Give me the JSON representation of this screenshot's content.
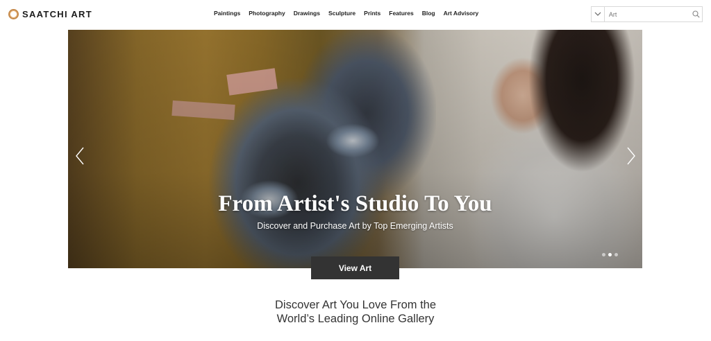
{
  "header": {
    "logo_text": "SAATCHI ART",
    "nav": [
      {
        "label": "Paintings"
      },
      {
        "label": "Photography"
      },
      {
        "label": "Drawings"
      },
      {
        "label": "Sculpture"
      },
      {
        "label": "Prints"
      },
      {
        "label": "Features"
      },
      {
        "label": "Blog"
      },
      {
        "label": "Art Advisory"
      }
    ],
    "search": {
      "placeholder": "Art",
      "value": "",
      "dropdown_icon": "chevron-down-icon",
      "button_icon": "search-icon"
    }
  },
  "hero": {
    "title": "From Artist's Studio To You",
    "subtitle": "Discover and Purchase Art by Top Emerging Artists",
    "prev_icon": "chevron-left-icon",
    "next_icon": "chevron-right-icon",
    "slides_count": 3,
    "active_slide": 2
  },
  "cta": {
    "label": "View Art"
  },
  "tagline": {
    "line1": "Discover Art You Love From the",
    "line2": "World’s Leading Online Gallery"
  },
  "colors": {
    "logo_ring": "#c5894a",
    "button_bg": "#333333",
    "text": "#222222"
  }
}
